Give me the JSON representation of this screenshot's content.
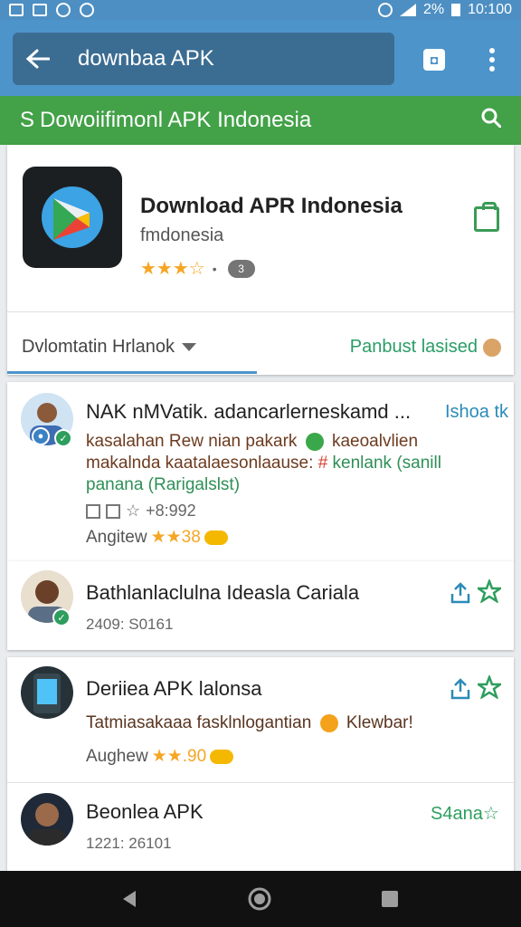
{
  "status_bar": {
    "battery": "2%",
    "time": "10:100"
  },
  "search": {
    "query": "downbaa APK"
  },
  "banner": {
    "prefix": "S",
    "title": "Dowoiifimonl APK Indonesia"
  },
  "app": {
    "title": "Download APR Indonesia",
    "subtitle": "fmdonesia",
    "stars": "★★★☆"
  },
  "filter": {
    "label": "Dvlomtatin Hrlanok",
    "publish_label": "Panbust lasised"
  },
  "reviews": [
    {
      "title": "NAK nMVatik. adancarlerneskamd ...",
      "side": "Ishoa tk",
      "line1": "kasalahan Rew nian pakark",
      "line1b": "kaeoalvlien",
      "line2": "makalnda kaatalaesonlaause:",
      "line2b": "kenlank (sanill",
      "line3": "panana (Rarigalslst)",
      "meta": "+8:992",
      "rating_label": "Angitew",
      "rating_value": "★★38"
    },
    {
      "title": "Bathlanlaclulna Ideasla Cariala",
      "date": "2409: S0161"
    },
    {
      "title": "Deriiea APK lalonsa",
      "line1": "Tatmiasakaaa fasklnlogantian",
      "line1b": "Klewbar!",
      "rating_label": "Aughew",
      "rating_value": "★★.90"
    },
    {
      "title": "Beonlea APK",
      "date": "1221: 26101",
      "side": "S4ana"
    }
  ],
  "colors": {
    "appbar": "#4d94cb",
    "banner": "#43a148",
    "accent_green": "#2e8f56",
    "star": "#f5a623"
  }
}
